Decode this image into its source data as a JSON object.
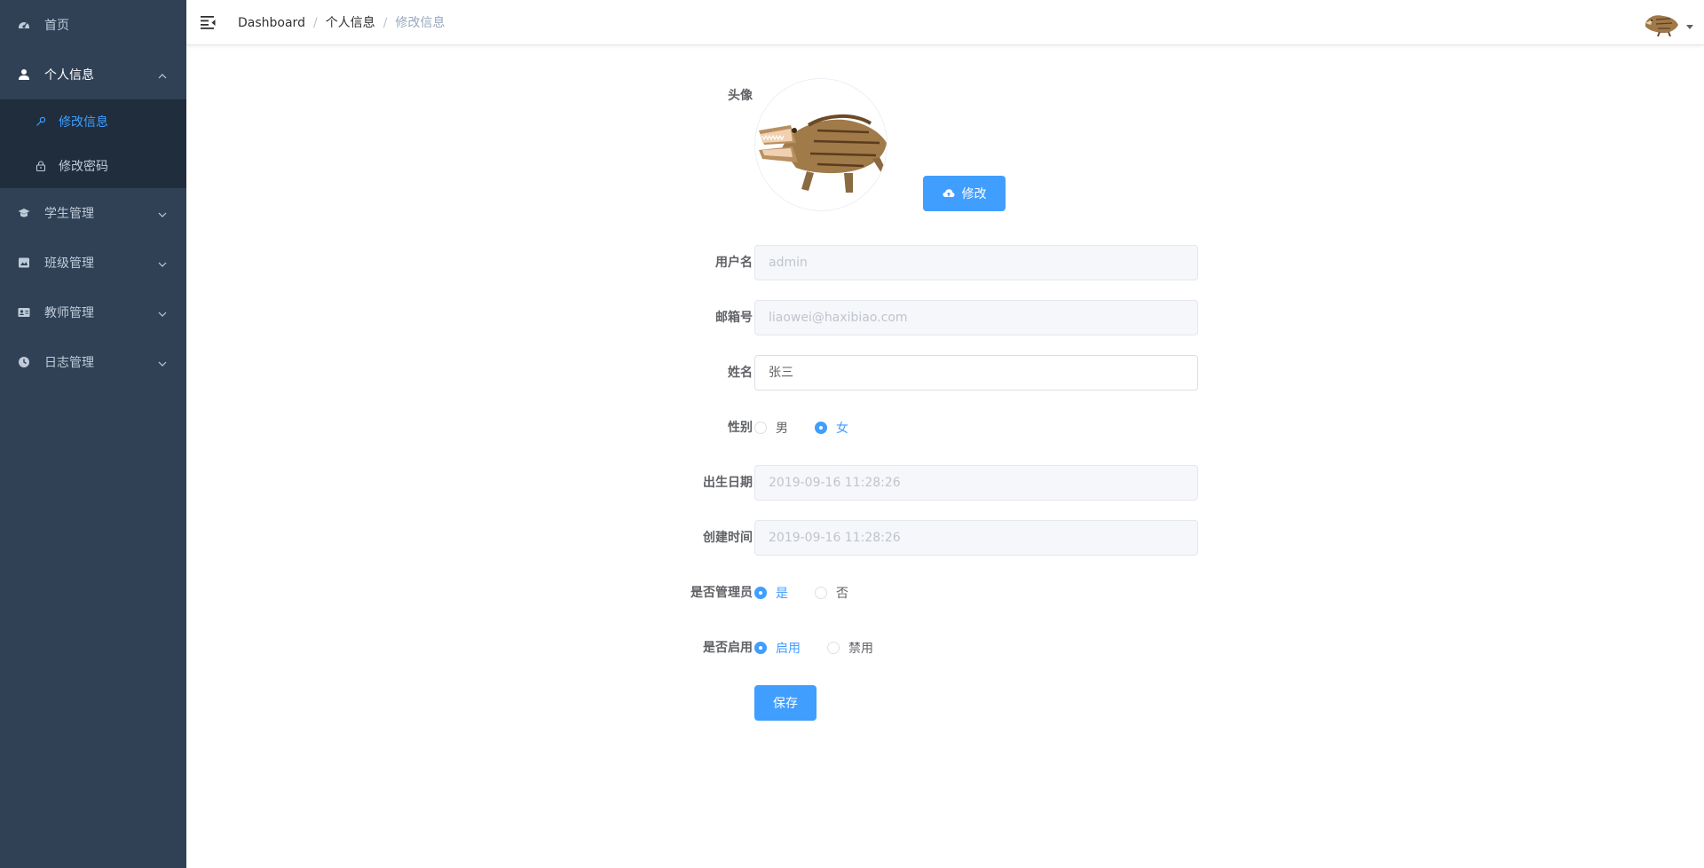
{
  "sidebar": {
    "items": [
      {
        "label": "首页",
        "icon": "dashboard-icon"
      },
      {
        "label": "个人信息",
        "icon": "user-icon"
      },
      {
        "label": "学生管理",
        "icon": "graduation-icon"
      },
      {
        "label": "班级管理",
        "icon": "class-icon"
      },
      {
        "label": "教师管理",
        "icon": "teacher-icon"
      },
      {
        "label": "日志管理",
        "icon": "clock-icon"
      }
    ],
    "sub_items": [
      {
        "label": "修改信息",
        "icon": "key-icon"
      },
      {
        "label": "修改密码",
        "icon": "lock-icon"
      }
    ]
  },
  "navbar": {
    "breadcrumb": [
      "Dashboard",
      "个人信息",
      "修改信息"
    ],
    "separator": "/"
  },
  "form": {
    "avatar_label": "头像",
    "upload_label": "修改",
    "username_label": "用户名",
    "username_value": "admin",
    "email_label": "邮箱号",
    "email_value": "liaowei@haxibiao.com",
    "name_label": "姓名",
    "name_value": "张三",
    "gender_label": "性别",
    "gender_options": [
      "男",
      "女"
    ],
    "gender_selected": "女",
    "birth_label": "出生日期",
    "birth_value": "2019-09-16 11:28:26",
    "created_label": "创建时间",
    "created_value": "2019-09-16 11:28:26",
    "admin_label": "是否管理员",
    "admin_options": [
      "是",
      "否"
    ],
    "admin_selected": "是",
    "enabled_label": "是否启用",
    "enabled_options": [
      "启用",
      "禁用"
    ],
    "enabled_selected": "启用",
    "save_label": "保存"
  },
  "colors": {
    "sidebar_bg": "#304156",
    "submenu_bg": "#1f2d3d",
    "sidebar_text": "#bfcbd9",
    "accent": "#409eff"
  }
}
